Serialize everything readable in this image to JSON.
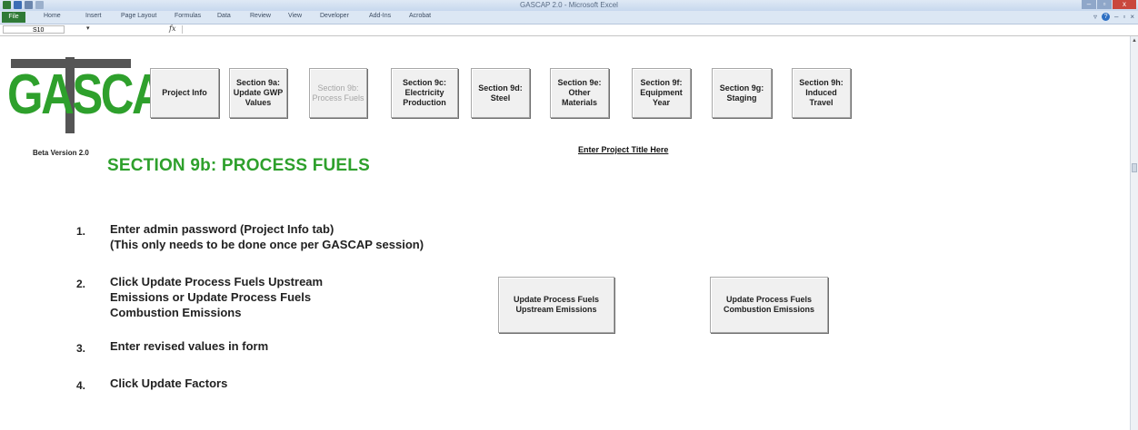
{
  "window": {
    "title": "GASCAP 2.0 - Microsoft Excel",
    "controls": [
      "–",
      "▫",
      "x"
    ]
  },
  "ribbon": {
    "file_tab": "File",
    "tabs": [
      "Home",
      "Insert",
      "Page Layout",
      "Formulas",
      "Data",
      "Review",
      "View",
      "Developer",
      "Add-Ins",
      "Acrobat"
    ]
  },
  "formula_bar": {
    "name_box": "S10",
    "fx_label": "fx",
    "value": ""
  },
  "logo": {
    "text": "GASCAP",
    "beta": "Beta Version 2.0"
  },
  "nav": [
    {
      "label": "Project Info",
      "enabled": true
    },
    {
      "label": "Section 9a:\nUpdate GWP\nValues",
      "enabled": true
    },
    {
      "label": "Section 9b:\nProcess Fuels",
      "enabled": false
    },
    {
      "label": "Section 9c:\nElectricity\nProduction",
      "enabled": true
    },
    {
      "label": "Section 9d:\nSteel",
      "enabled": true
    },
    {
      "label": "Section 9e:\nOther\nMaterials",
      "enabled": true
    },
    {
      "label": "Section 9f:\nEquipment\nYear",
      "enabled": true
    },
    {
      "label": "Section 9g:\nStaging",
      "enabled": true
    },
    {
      "label": "Section 9h:\nInduced\nTravel",
      "enabled": true
    }
  ],
  "section_title": "SECTION 9b: PROCESS FUELS",
  "project_title": "Enter Project Title Here",
  "steps": [
    {
      "num": "1.",
      "text": "Enter admin password (Project Info tab)\n(This only needs to be done once per GASCAP session)"
    },
    {
      "num": "2.",
      "text": "Click Update Process Fuels Upstream\nEmissions or Update Process Fuels\nCombustion Emissions"
    },
    {
      "num": "3.",
      "text": "Enter revised values in form"
    },
    {
      "num": "4.",
      "text": "Click Update Factors"
    }
  ],
  "actions": {
    "upstream": "Update Process Fuels\nUpstream Emissions",
    "combustion": "Update Process Fuels\nCombustion Emissions"
  },
  "colors": {
    "brand_green": "#2ea02c",
    "logo_gray": "#555555",
    "file_tab": "#2f7a36"
  }
}
